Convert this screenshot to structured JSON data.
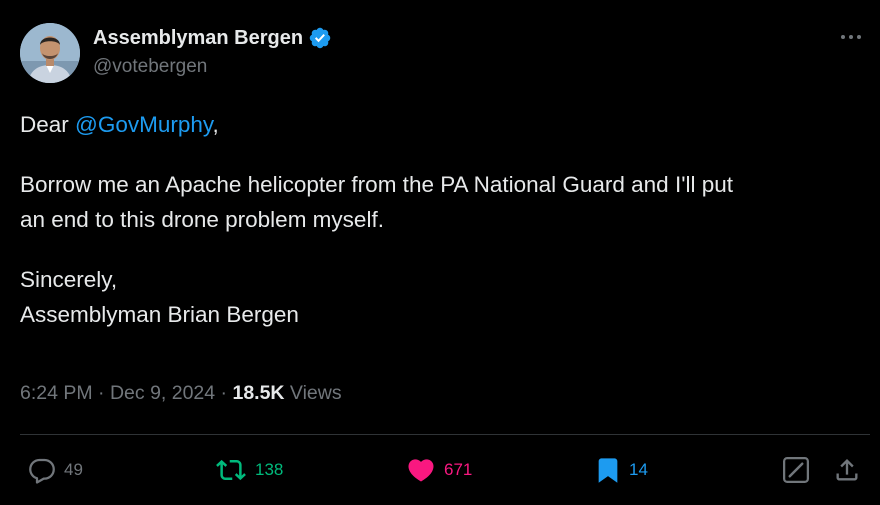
{
  "author": {
    "display_name": "Assemblyman Bergen",
    "handle": "@votebergen",
    "verified": true,
    "verified_color": "#1d9bf0",
    "avatar": "profile-photo"
  },
  "tweet": {
    "greeting_prefix": "Dear ",
    "mention": "@GovMurphy",
    "greeting_suffix": ",",
    "body_line1": "Borrow me an Apache helicopter from the PA National Guard and I'll put",
    "body_line2": "an end to this drone problem myself.",
    "closing": "Sincerely,",
    "signature": "Assemblyman Brian Bergen"
  },
  "meta": {
    "time": "6:24 PM",
    "separator": " · ",
    "date": "Dec 9, 2024",
    "views_count": "18.5K",
    "views_label": " Views"
  },
  "actions": {
    "replies": "49",
    "reposts": "138",
    "likes": "671",
    "bookmarks": "14"
  },
  "colors": {
    "background": "#000000",
    "text": "#e7e9ea",
    "secondary": "#71767b",
    "link": "#1d9bf0",
    "repost_active": "#00ba7c",
    "like_active": "#f91880",
    "bookmark_active": "#1d9bf0"
  }
}
